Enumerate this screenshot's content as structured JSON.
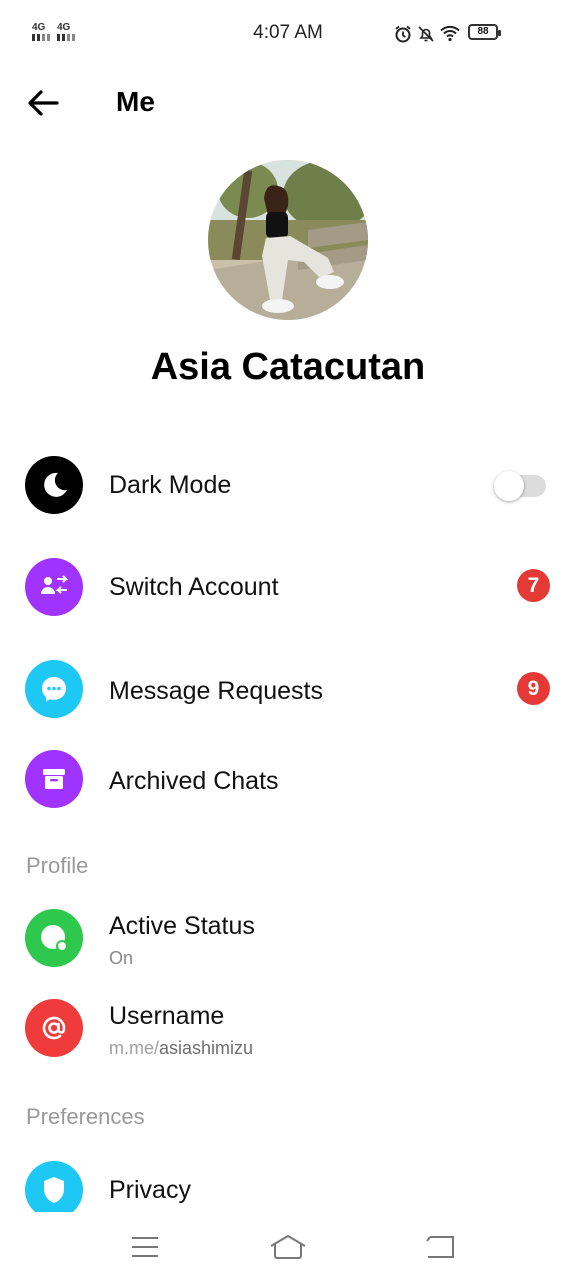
{
  "status_bar": {
    "signal1": "4G",
    "signal2": "4G",
    "time": "4:07 AM",
    "battery": "88",
    "icons": [
      "alarm-icon",
      "bell-off-icon",
      "wifi-icon",
      "battery-icon"
    ]
  },
  "header": {
    "title": "Me"
  },
  "profile": {
    "name": "Asia Catacutan"
  },
  "menu": {
    "dark_mode": {
      "label": "Dark Mode",
      "enabled": false,
      "icon": "moon-icon",
      "color": "#000000"
    },
    "switch_account": {
      "label": "Switch Account",
      "badge": "7",
      "icon": "switch-account-icon",
      "color": "#a033ff"
    },
    "message_requests": {
      "label": "Message Requests",
      "badge": "9",
      "icon": "chat-bubble-icon",
      "color": "#1ec8f5"
    },
    "archived_chats": {
      "label": "Archived Chats",
      "icon": "archive-box-icon",
      "color": "#a033ff"
    }
  },
  "sections": {
    "profile": "Profile",
    "preferences": "Preferences"
  },
  "profile_items": {
    "active_status": {
      "label": "Active Status",
      "value": "On",
      "icon": "active-status-icon",
      "color": "#2dc84d"
    },
    "username": {
      "label": "Username",
      "prefix": "m.me/",
      "handle": "asiashimizu",
      "icon": "at-sign-icon",
      "color": "#ef3b3b"
    }
  },
  "preferences_items": {
    "privacy": {
      "label": "Privacy",
      "icon": "shield-icon",
      "color": "#1ec8f5"
    }
  },
  "nav": {
    "icons": [
      "menu-icon",
      "home-icon",
      "back-icon"
    ]
  }
}
